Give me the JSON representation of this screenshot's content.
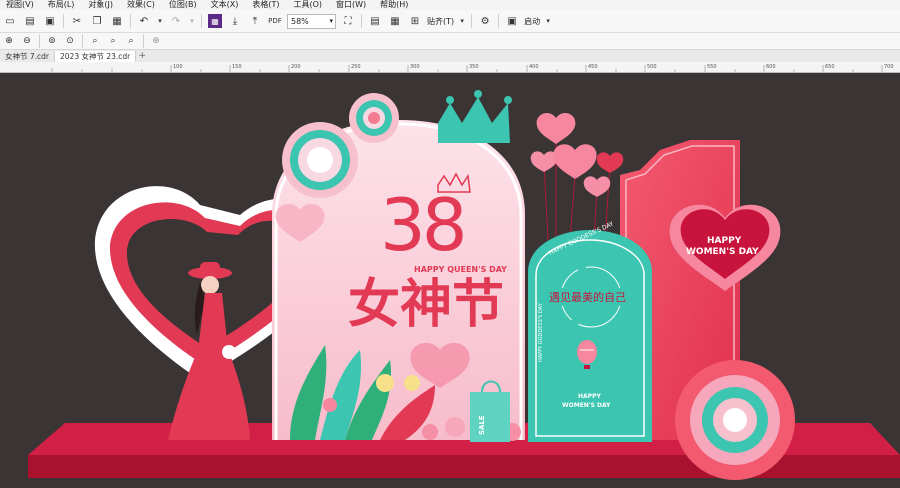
{
  "menu": {
    "items": [
      "视图(V)",
      "布局(L)",
      "对象(J)",
      "效果(C)",
      "位图(B)",
      "文本(X)",
      "表格(T)",
      "工具(O)",
      "窗口(W)",
      "帮助(H)"
    ]
  },
  "toolbar": {
    "zoom_value": "58%",
    "snap_label": "贴齐(T)",
    "launch_label": "启动"
  },
  "tabs": {
    "items": [
      "女神节 7.cdr",
      "2023 女神节 23.cdr"
    ],
    "active_index": 1
  },
  "ruler": {
    "marks": [
      "100",
      "150",
      "200",
      "250",
      "300",
      "350",
      "400",
      "450",
      "500",
      "550",
      "600",
      "650",
      "700",
      "750"
    ]
  },
  "artwork": {
    "big_number": "38",
    "tagline_en": "HAPPY QUEEN'S DAY",
    "title_cn": "女神节",
    "arc_text": "HAPPY GODDESS'S DAY",
    "side_text": "HAPPY GODDESS'S DAY",
    "slogan_cn": "遇见最美的自己",
    "card_line1": "HAPPY",
    "card_line2": "WOMEN'S DAY",
    "heart_line1": "HAPPY",
    "heart_line2": "WOMEN'S DAY",
    "bag_text": "SALE"
  },
  "colors": {
    "canvas_bg": "#3a3434",
    "red": "#e23a54",
    "pink": "#f6c3cf",
    "teal": "#3cc5b0",
    "crimson": "#c8143c"
  }
}
